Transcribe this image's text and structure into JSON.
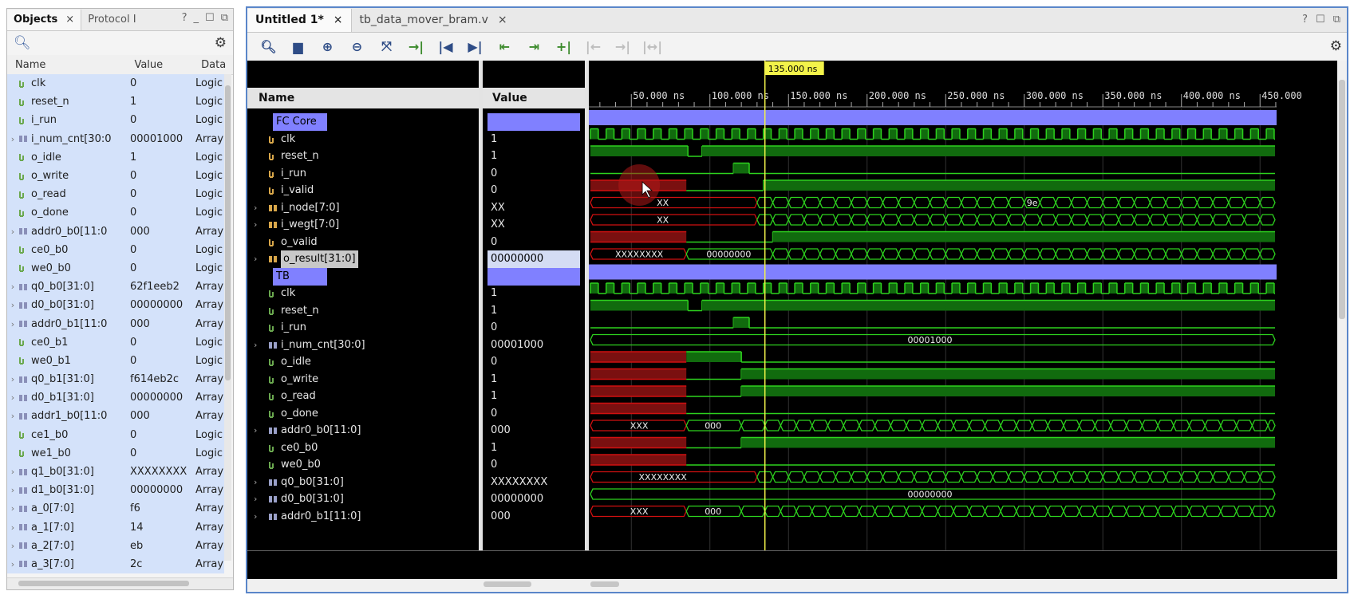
{
  "objects_panel": {
    "tab_objects": "Objects",
    "tab_protocol": "Protocol I",
    "col_name": "Name",
    "col_value": "Value",
    "col_data": "Data",
    "rows": [
      {
        "name": "clk",
        "value": "0",
        "type": "Logic",
        "expandable": false,
        "kind": "bit"
      },
      {
        "name": "reset_n",
        "value": "1",
        "type": "Logic",
        "expandable": false,
        "kind": "bit"
      },
      {
        "name": "i_run",
        "value": "0",
        "type": "Logic",
        "expandable": false,
        "kind": "bit"
      },
      {
        "name": "i_num_cnt[30:0",
        "value": "00001000",
        "type": "Array",
        "expandable": true,
        "kind": "bus"
      },
      {
        "name": "o_idle",
        "value": "1",
        "type": "Logic",
        "expandable": false,
        "kind": "bit"
      },
      {
        "name": "o_write",
        "value": "0",
        "type": "Logic",
        "expandable": false,
        "kind": "bit"
      },
      {
        "name": "o_read",
        "value": "0",
        "type": "Logic",
        "expandable": false,
        "kind": "bit"
      },
      {
        "name": "o_done",
        "value": "0",
        "type": "Logic",
        "expandable": false,
        "kind": "bit"
      },
      {
        "name": "addr0_b0[11:0",
        "value": "000",
        "type": "Array",
        "expandable": true,
        "kind": "bus"
      },
      {
        "name": "ce0_b0",
        "value": "0",
        "type": "Logic",
        "expandable": false,
        "kind": "bit"
      },
      {
        "name": "we0_b0",
        "value": "0",
        "type": "Logic",
        "expandable": false,
        "kind": "bit"
      },
      {
        "name": "q0_b0[31:0]",
        "value": "62f1eeb2",
        "type": "Array",
        "expandable": true,
        "kind": "bus"
      },
      {
        "name": "d0_b0[31:0]",
        "value": "00000000",
        "type": "Array",
        "expandable": true,
        "kind": "bus"
      },
      {
        "name": "addr0_b1[11:0",
        "value": "000",
        "type": "Array",
        "expandable": true,
        "kind": "bus"
      },
      {
        "name": "ce0_b1",
        "value": "0",
        "type": "Logic",
        "expandable": false,
        "kind": "bit"
      },
      {
        "name": "we0_b1",
        "value": "0",
        "type": "Logic",
        "expandable": false,
        "kind": "bit"
      },
      {
        "name": "q0_b1[31:0]",
        "value": "f614eb2c",
        "type": "Array",
        "expandable": true,
        "kind": "bus"
      },
      {
        "name": "d0_b1[31:0]",
        "value": "00000000",
        "type": "Array",
        "expandable": true,
        "kind": "bus"
      },
      {
        "name": "addr1_b0[11:0",
        "value": "000",
        "type": "Array",
        "expandable": true,
        "kind": "bus"
      },
      {
        "name": "ce1_b0",
        "value": "0",
        "type": "Logic",
        "expandable": false,
        "kind": "bit"
      },
      {
        "name": "we1_b0",
        "value": "0",
        "type": "Logic",
        "expandable": false,
        "kind": "bit"
      },
      {
        "name": "q1_b0[31:0]",
        "value": "XXXXXXXX",
        "type": "Array",
        "expandable": true,
        "kind": "bus"
      },
      {
        "name": "d1_b0[31:0]",
        "value": "00000000",
        "type": "Array",
        "expandable": true,
        "kind": "bus"
      },
      {
        "name": "a_0[7:0]",
        "value": "f6",
        "type": "Array",
        "expandable": true,
        "kind": "bus"
      },
      {
        "name": "a_1[7:0]",
        "value": "14",
        "type": "Array",
        "expandable": true,
        "kind": "bus"
      },
      {
        "name": "a_2[7:0]",
        "value": "eb",
        "type": "Array",
        "expandable": true,
        "kind": "bus"
      },
      {
        "name": "a_3[7:0]",
        "value": "2c",
        "type": "Array",
        "expandable": true,
        "kind": "bus"
      }
    ]
  },
  "wave_window": {
    "tab_active": "Untitled 1*",
    "tab_other": "tb_data_mover_bram.v",
    "col_name": "Name",
    "col_value": "Value",
    "cursor_label": "135.000 ns",
    "time_ticks": [
      "50.000 ns",
      "100.000 ns",
      "150.000 ns",
      "200.000 ns",
      "250.000 ns",
      "300.000 ns",
      "350.000 ns",
      "400.000 ns",
      "450.000"
    ],
    "rows": [
      {
        "name": "FC Core",
        "value": "",
        "group": true,
        "kind": "group",
        "wave": "group"
      },
      {
        "name": "clk",
        "value": "1",
        "kind": "bit",
        "wave": "clk"
      },
      {
        "name": "reset_n",
        "value": "1",
        "kind": "bit",
        "wave": "reset"
      },
      {
        "name": "i_run",
        "value": "0",
        "kind": "bit",
        "wave": "run"
      },
      {
        "name": "i_valid",
        "value": "0",
        "kind": "bit",
        "wave": "valid"
      },
      {
        "name": "i_node[7:0]",
        "value": "XX",
        "kind": "bus",
        "expandable": true,
        "wave": "bus_node",
        "left_text": "XX",
        "right_text": "9e"
      },
      {
        "name": "i_wegt[7:0]",
        "value": "XX",
        "kind": "bus",
        "expandable": true,
        "wave": "bus_wegt",
        "left_text": "XX"
      },
      {
        "name": "o_valid",
        "value": "0",
        "kind": "bit",
        "wave": "ovalid"
      },
      {
        "name": "o_result[31:0]",
        "value": "00000000",
        "kind": "bus",
        "expandable": true,
        "selected": true,
        "wave": "bus_result",
        "left_text": "XXXXXXXX",
        "mid_text": "00000000"
      },
      {
        "name": "TB",
        "value": "",
        "group": true,
        "kind": "group",
        "wave": "group"
      },
      {
        "name": "clk",
        "value": "1",
        "kind": "bit",
        "wave": "clk"
      },
      {
        "name": "reset_n",
        "value": "1",
        "kind": "bit",
        "wave": "reset"
      },
      {
        "name": "i_run",
        "value": "0",
        "kind": "bit",
        "wave": "run"
      },
      {
        "name": "i_num_cnt[30:0]",
        "value": "00001000",
        "kind": "bus",
        "expandable": true,
        "wave": "bus_const",
        "mid_text": "00001000"
      },
      {
        "name": "o_idle",
        "value": "0",
        "kind": "bit",
        "wave": "idle"
      },
      {
        "name": "o_write",
        "value": "1",
        "kind": "bit",
        "wave": "high_after"
      },
      {
        "name": "o_read",
        "value": "1",
        "kind": "bit",
        "wave": "high_after"
      },
      {
        "name": "o_done",
        "value": "0",
        "kind": "bit",
        "wave": "done"
      },
      {
        "name": "addr0_b0[11:0]",
        "value": "000",
        "kind": "bus",
        "expandable": true,
        "wave": "bus_addr",
        "left_text": "XXX",
        "mid_text": "000"
      },
      {
        "name": "ce0_b0",
        "value": "1",
        "kind": "bit",
        "wave": "high_after"
      },
      {
        "name": "we0_b0",
        "value": "0",
        "kind": "bit",
        "wave": "done"
      },
      {
        "name": "q0_b0[31:0]",
        "value": "XXXXXXXX",
        "kind": "bus",
        "expandable": true,
        "wave": "bus_q0",
        "left_text": "XXXXXXXX"
      },
      {
        "name": "d0_b0[31:0]",
        "value": "00000000",
        "kind": "bus",
        "expandable": true,
        "wave": "bus_const",
        "mid_text": "00000000"
      },
      {
        "name": "addr0_b1[11:0]",
        "value": "000",
        "kind": "bus",
        "expandable": true,
        "wave": "bus_addr",
        "left_text": "XXX",
        "mid_text": "000"
      }
    ]
  }
}
